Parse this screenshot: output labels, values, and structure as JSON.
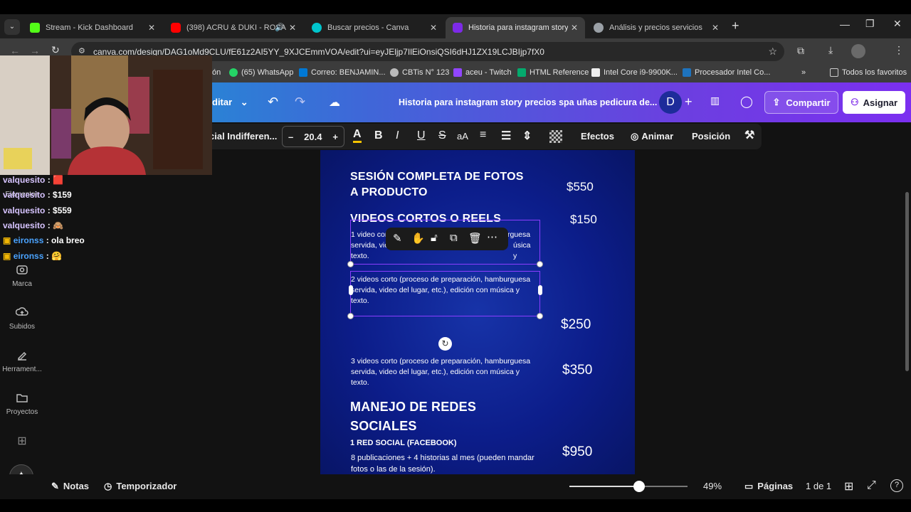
{
  "browser": {
    "tabs": [
      {
        "label": "Stream - Kick Dashboard",
        "favicon_color": "#53fc18",
        "favicon_icon": "kick-icon"
      },
      {
        "label": "(398) ACRU & DUKI - ROSA",
        "favicon_color": "#ff0000",
        "favicon_icon": "youtube-icon"
      },
      {
        "label": "Buscar precios - Canva",
        "favicon_color": "#00c4cc",
        "favicon_icon": "canva-icon"
      },
      {
        "label": "Historia para instagram story pi",
        "favicon_color": "#7d2ae8",
        "favicon_icon": "canva-icon"
      },
      {
        "label": "Análisis y precios servicios",
        "favicon_color": "#9aa0a6",
        "favicon_icon": "openai-icon"
      }
    ],
    "url": "canva.com/design/DAG1oMd9CLU/fE61z2AI5YY_9XJCEmmVOA/edit?ui=eyJEljp7IlEiOnsiQSI6dHJ1ZX19LCJBIjp7fX0",
    "bookmarks": [
      {
        "label": "ón",
        "color": "#888888"
      },
      {
        "label": "(65) WhatsApp",
        "color": "#25d366"
      },
      {
        "label": "Correo: BENJAMIN...",
        "color": "#0078d4"
      },
      {
        "label": "CBTis N° 123",
        "color": "#cccccc"
      },
      {
        "label": "aceu - Twitch",
        "color": "#9146ff"
      },
      {
        "label": "HTML Reference",
        "color": "#04aa6d"
      },
      {
        "label": "Intel Core i9-9900K...",
        "color": "#eeeeee"
      },
      {
        "label": "Procesador Intel Co...",
        "color": "#1e73be"
      }
    ],
    "all_bookmarks": "Todos los favoritos"
  },
  "canva_header": {
    "edit_menu": "ditar",
    "doc_title": "Historia para instagram story precios spa uñas pedicura de...",
    "avatar_letter": "D",
    "share": "Compartir",
    "assign": "Asignar"
  },
  "toolbar": {
    "font": "cial Indifferen...",
    "font_size": "20.4",
    "effects": "Efectos",
    "animate": "Animar",
    "position": "Posición"
  },
  "sidebar": [
    {
      "label": "Elementos",
      "icon": "elements-icon"
    },
    {
      "label": "Marca",
      "icon": "brand-icon"
    },
    {
      "label": "Subidos",
      "icon": "upload-icon"
    },
    {
      "label": "Herrament...",
      "icon": "tools-icon"
    },
    {
      "label": "Proyectos",
      "icon": "folder-icon"
    }
  ],
  "design": {
    "s1_title_1": "SESIÓN COMPLETA DE FOTOS",
    "s1_title_2": "A PRODUCTO",
    "s1_price": "$550",
    "s2_title": "VIDEOS CORTOS O REELS",
    "s2_price": "$150",
    "d1_a": "1 video cort",
    "d1_a2": "rguesa",
    "d1_b": "servida,  vic",
    "d1_b2": "úsica y",
    "d1_c": "texto.",
    "d2_a": "2 videos corto (proceso de preparación, hamburguesa",
    "d2_b": "servida,  video del lugar, etc.), edición con música y",
    "d2_c": "texto.",
    "price_250": "$250",
    "d3_a": "3 videos corto (proceso de preparación, hamburguesa",
    "d3_b": "servida,  video del lugar, etc.), edición con música y",
    "d3_c": "texto.",
    "price_350": "$350",
    "s3_title_1": "MANEJO DE REDES",
    "s3_title_2": "SOCIALES",
    "s3_sub": "1 RED SOCIAL (FACEBOOK)",
    "s3_desc_1": "8 publicaciones + 4 historias al mes (pueden mandar",
    "s3_desc_2": "fotos o las de la sesión).",
    "price_950": "$950"
  },
  "bottom": {
    "notes": "Notas",
    "timer": "Temporizador",
    "zoom": "49%",
    "zoom_fraction": 0.49,
    "pages": "Páginas",
    "page_count": "1 de 1"
  },
  "chat": [
    {
      "user": "valquesito",
      "msg": "🟥"
    },
    {
      "user": "valquesito",
      "msg": "$159"
    },
    {
      "user": "valquesito",
      "msg": "$559"
    },
    {
      "user": "valquesito",
      "msg": "🙈"
    },
    {
      "user": "eironss",
      "msg": "ola breo"
    },
    {
      "user": "eironss",
      "msg": "🤗"
    }
  ]
}
